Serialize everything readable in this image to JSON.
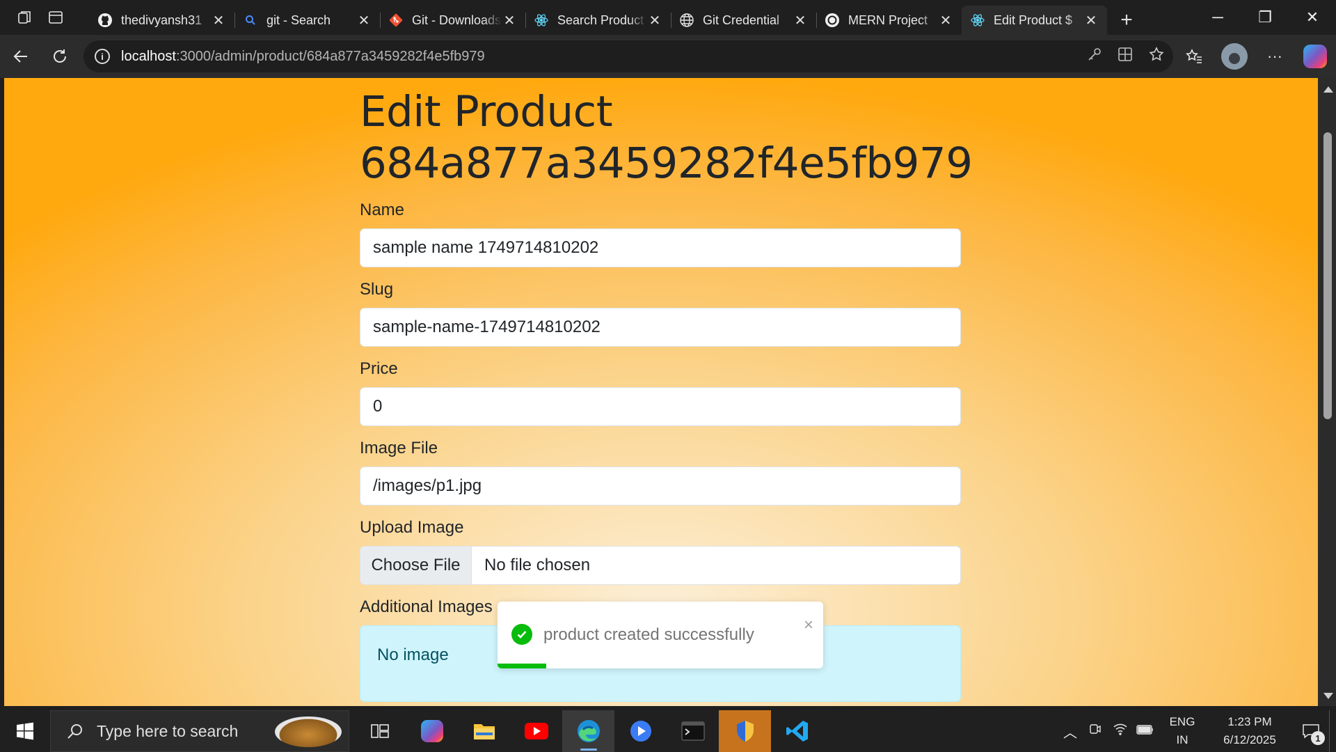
{
  "browser": {
    "tabs": [
      {
        "title": "thedivyansh31",
        "favicon": "github-icon"
      },
      {
        "title": "git - Search",
        "favicon": "search-icon"
      },
      {
        "title": "Git - Downloads",
        "favicon": "git-icon"
      },
      {
        "title": "Search Product",
        "favicon": "react-icon"
      },
      {
        "title": "Git Credential",
        "favicon": "globe-icon"
      },
      {
        "title": "MERN Project",
        "favicon": "openai-icon"
      },
      {
        "title": "Edit Product $",
        "favicon": "react-icon",
        "active": true
      }
    ],
    "url_host": "localhost",
    "url_path": ":3000/admin/product/684a877a3459282f4e5fb979"
  },
  "page": {
    "title": "Edit Product 684a877a3459282f4e5fb979",
    "fields": {
      "name": {
        "label": "Name",
        "value": "sample name 1749714810202"
      },
      "slug": {
        "label": "Slug",
        "value": "sample-name-1749714810202"
      },
      "price": {
        "label": "Price",
        "value": "0"
      },
      "image": {
        "label": "Image File",
        "value": "/images/p1.jpg"
      },
      "upload": {
        "label": "Upload Image",
        "button": "Choose File",
        "status": "No file chosen"
      },
      "additional": {
        "label": "Additional Images",
        "empty": "No image"
      }
    }
  },
  "toast": {
    "message": "product created successfully",
    "close": "×",
    "progress": 0.15,
    "color": "#07bc0c"
  },
  "taskbar": {
    "search_placeholder": "Type here to search",
    "lang_line1": "ENG",
    "lang_line2": "IN",
    "time": "1:23 PM",
    "date": "6/12/2025",
    "notification_count": "1"
  }
}
